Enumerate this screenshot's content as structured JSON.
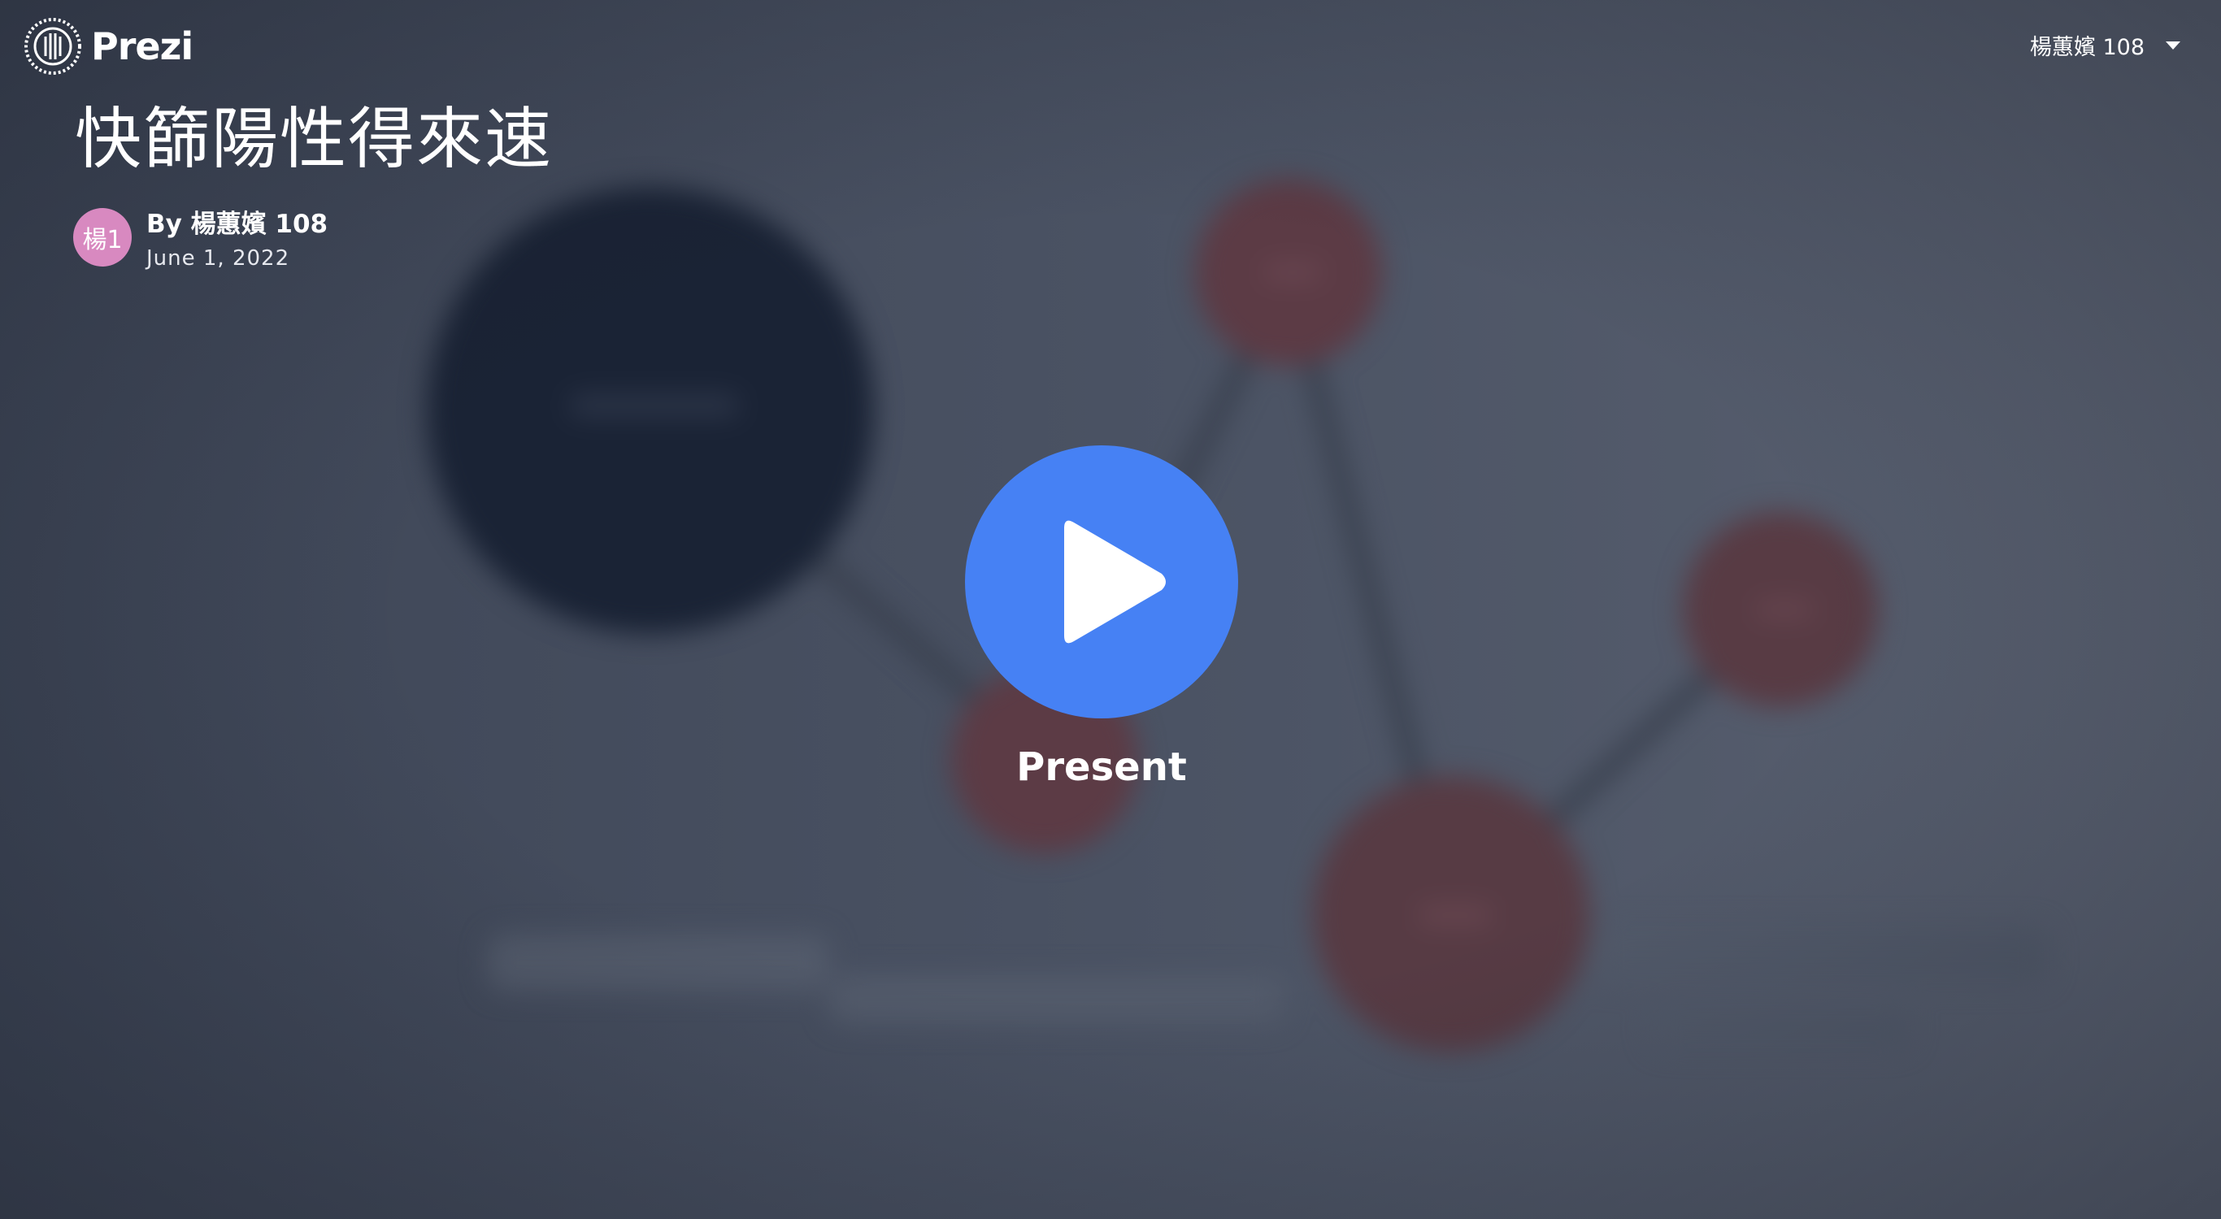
{
  "app": {
    "brand": "Prezi",
    "logo_icon": "prezi-logo-icon"
  },
  "header": {
    "user_name": "楊蕙嬪 108",
    "menu_icon": "chevron-down-icon"
  },
  "presentation": {
    "title": "快篩陽性得來速",
    "author": {
      "avatar_initials": "楊1",
      "avatar_color": "#d889c0",
      "byline": "By 楊蕙嬪 108",
      "date": "June 1, 2022"
    }
  },
  "present_button": {
    "label": "Present",
    "icon": "play-icon",
    "color": "#4681f4"
  },
  "background": {
    "description_colors": {
      "dark_node": "#1a2335",
      "red_node": "#5c3b45",
      "connector": "#39404e"
    }
  }
}
